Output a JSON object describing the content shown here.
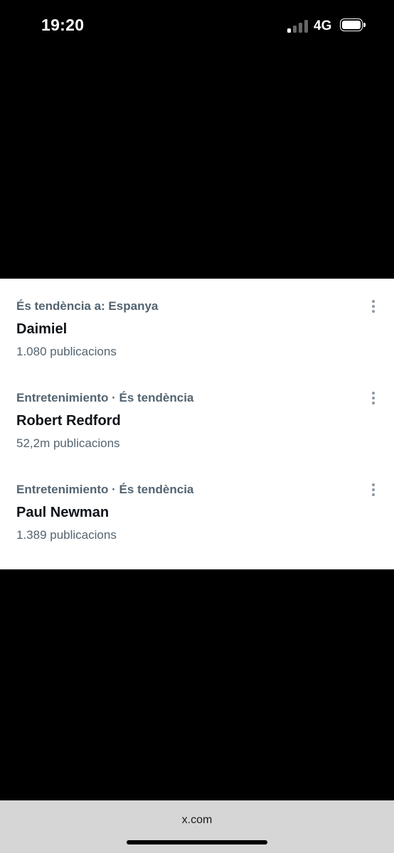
{
  "status_bar": {
    "time": "19:20",
    "network": "4G",
    "signal_bars_active": 1,
    "signal_bars_total": 4,
    "battery_icon": "battery-full-icon"
  },
  "trends": [
    {
      "context": "És tendència a: Espanya",
      "name": "Daimiel",
      "count": "1.080 publicacions"
    },
    {
      "context": "Entretenimiento · És tendència",
      "name": "Robert Redford",
      "count": "52,2m publicacions"
    },
    {
      "context": "Entretenimiento · És tendència",
      "name": "Paul Newman",
      "count": "1.389 publicacions"
    }
  ],
  "browser": {
    "url": "x.com"
  },
  "colors": {
    "background": "#000000",
    "panel": "#ffffff",
    "primary_text": "#0f1419",
    "secondary_text": "#536471",
    "browser_bar": "#d6d6d6"
  }
}
